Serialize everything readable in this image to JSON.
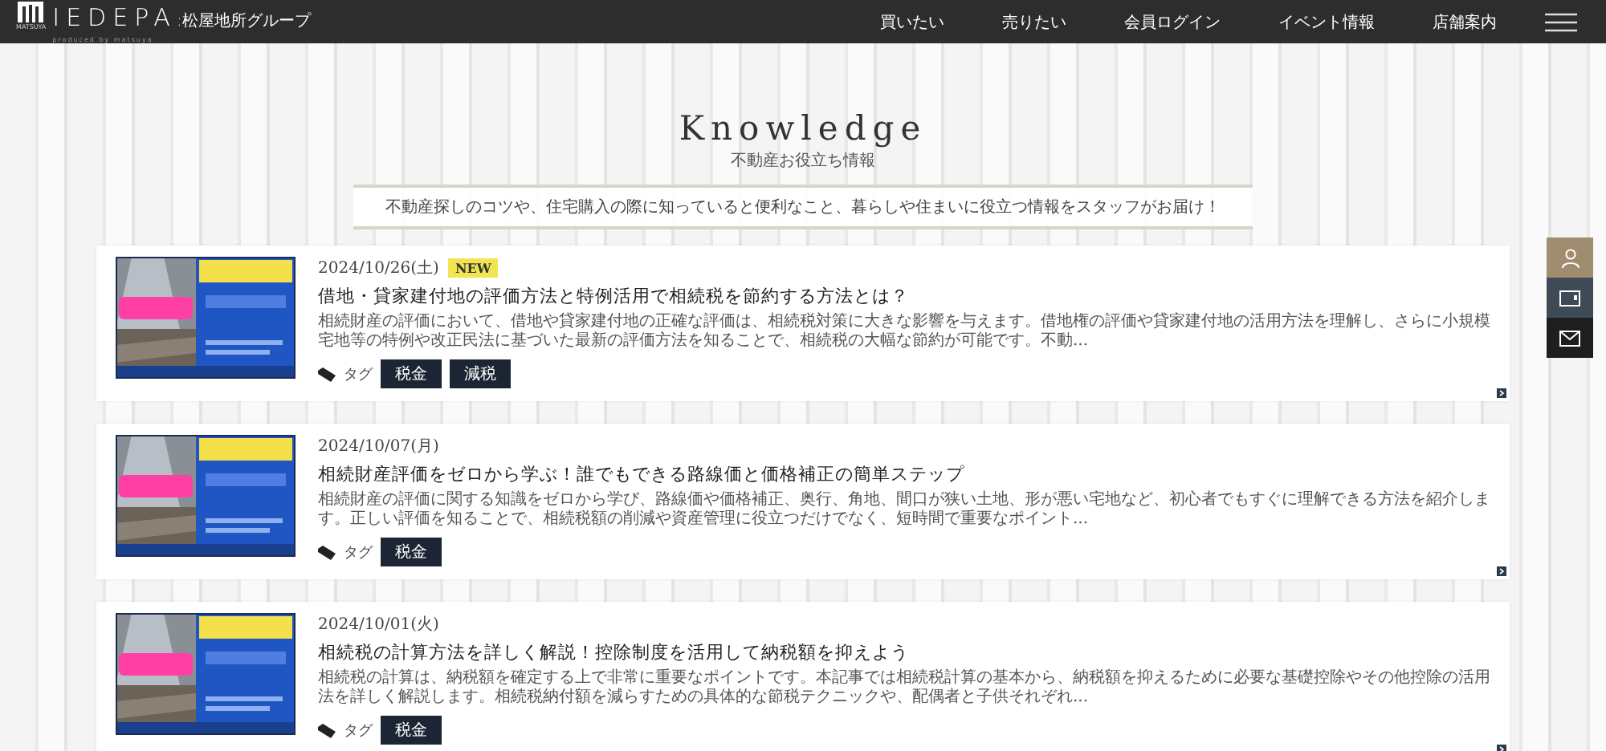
{
  "header": {
    "logo_caption": "MATSUYA",
    "logo_text": "IEDEPA",
    "logo_suffix": ":松屋地所グループ",
    "tagline": "produced by matsuya",
    "nav": [
      "買いたい",
      "売りたい",
      "会員ログイン",
      "イベント情報",
      "店舗案内"
    ]
  },
  "section": {
    "title": "Knowledge",
    "subtitle": "不動産お役立ち情報",
    "intro": "不動産探しのコツや、住宅購入の際に知っていると便利なこと、暮らしや住まいに役立つ情報をスタッフがお届け！"
  },
  "articles": [
    {
      "date": "2024/10/26(土)",
      "new": true,
      "badge": "NEW",
      "title": "借地・貸家建付地の評価方法と特例活用で相続税を節約する方法とは？",
      "excerpt": "相続財産の評価において、借地や貸家建付地の正確な評価は、相続税対策に大きな影響を与えます。借地権の評価や貸家建付地の活用方法を理解し、さらに小規模宅地等の特例や改正民法に基づいた最新の評価方法を知ることで、相続税の大幅な節約が可能です。不動...",
      "tag_label": "タグ",
      "tags": [
        "税金",
        "減税"
      ]
    },
    {
      "date": "2024/10/07(月)",
      "new": false,
      "title": "相続財産評価をゼロから学ぶ！誰でもできる路線価と価格補正の簡単ステップ",
      "excerpt": "相続財産の評価に関する知識をゼロから学び、路線価や価格補正、奥行、角地、間口が狭い土地、形が悪い宅地など、初心者でもすぐに理解できる方法を紹介します。正しい評価を知ることで、相続税額の削減や資産管理に役立つだけでなく、短時間で重要なポイント...",
      "tag_label": "タグ",
      "tags": [
        "税金"
      ]
    },
    {
      "date": "2024/10/01(火)",
      "new": false,
      "title": "相続税の計算方法を詳しく解説！控除制度を活用して納税額を抑えよう",
      "excerpt": "相続税の計算は、納税額を確定する上で非常に重要なポイントです。本記事では相続税計算の基本から、納税額を抑えるために必要な基礎控除やその他控除の活用法を詳しく解説します。相続税納付額を減らすための具体的な節税テクニックや、配偶者と子供それぞれ...",
      "tag_label": "タグ",
      "tags": [
        "税金"
      ]
    }
  ]
}
